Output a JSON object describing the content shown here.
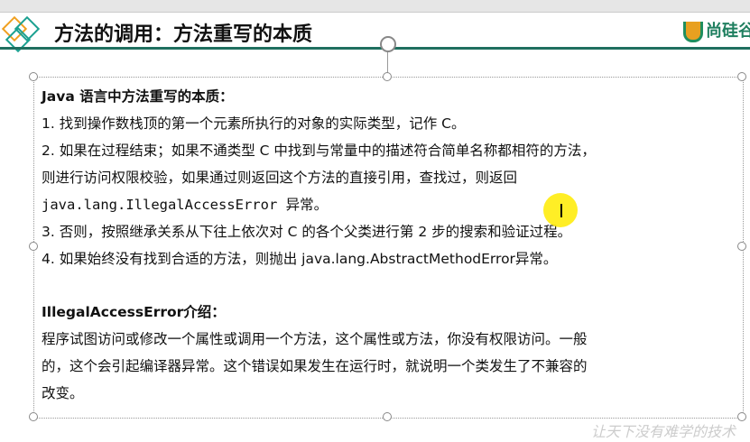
{
  "slide": {
    "title": "方法的调用：方法重写的本质",
    "logo": "尚硅谷",
    "watermark": "让天下没有难学的技术"
  },
  "content": {
    "heading1": "Java 语言中方法重写的本质：",
    "items": [
      "1. 找到操作数栈顶的第一个元素所执行的对象的实际类型，记作 C。",
      "2. 如果在过程结束；如果不通类型 C 中找到与常量中的描述符合简单名称都相符的方法，",
      "则进行访问权限校验，如果通过则返回这个方法的直接引用，查找过，则返回",
      "java.lang.IllegalAccessError 异常。",
      "3. 否则，按照继承关系从下往上依次对 C 的各个父类进行第 2 步的搜索和验证过程。",
      "4. 如果始终没有找到合适的方法，则抛出 java.lang.AbstractMethodError异常。"
    ],
    "heading2": "IllegalAccessError介绍：",
    "para": [
      "程序试图访问或修改一个属性或调用一个方法，这个属性或方法，你没有权限访问。一般",
      "的，这个会引起编译器异常。这个错误如果发生在运行时，就说明一个类发生了不兼容的",
      "改变。"
    ]
  },
  "colors": {
    "accent": "#1f6f5f",
    "highlight": "#ffeb00"
  }
}
